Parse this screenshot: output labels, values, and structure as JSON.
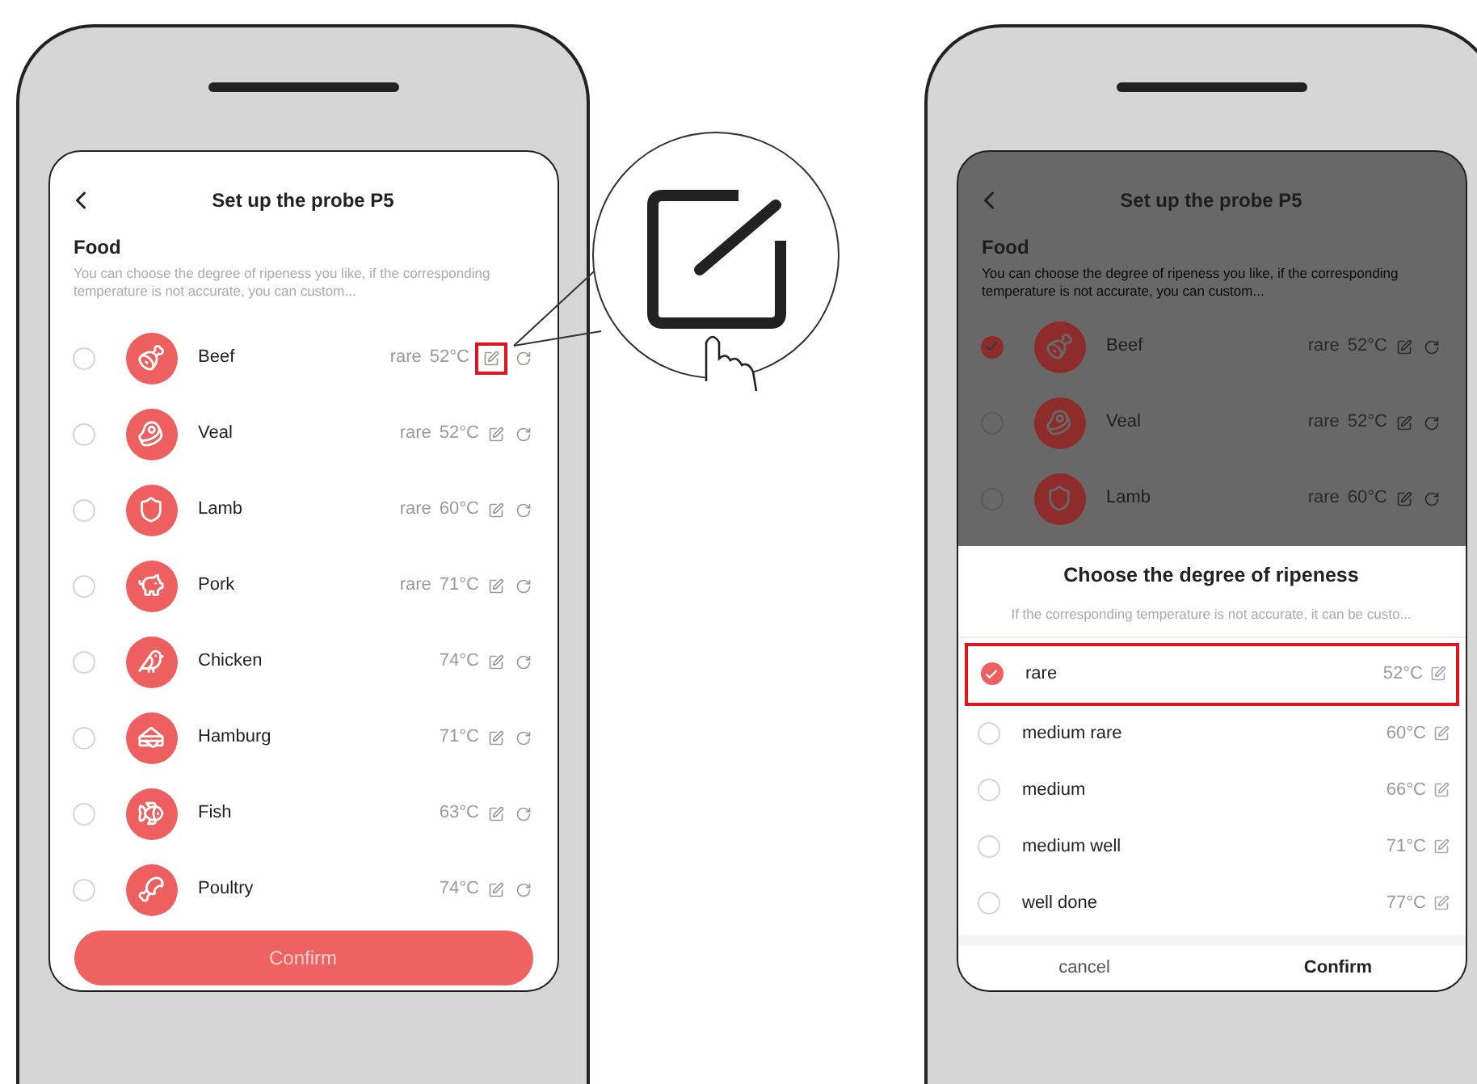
{
  "left_screen": {
    "title": "Set up the probe P5",
    "section_title": "Food",
    "description": "You can choose the degree of ripeness you like, if the corresponding temperature is not accurate, you can custom...",
    "foods": [
      {
        "name": "Beef",
        "doneness": "rare",
        "temp": "52°C",
        "selected": false
      },
      {
        "name": "Veal",
        "doneness": "rare",
        "temp": "52°C",
        "selected": false
      },
      {
        "name": "Lamb",
        "doneness": "rare",
        "temp": "60°C",
        "selected": false
      },
      {
        "name": "Pork",
        "doneness": "rare",
        "temp": "71°C",
        "selected": false
      },
      {
        "name": "Chicken",
        "temp": "74°C",
        "selected": false
      },
      {
        "name": "Hamburg",
        "temp": "71°C",
        "selected": false
      },
      {
        "name": "Fish",
        "temp": "63°C",
        "selected": false
      },
      {
        "name": "Poultry",
        "temp": "74°C",
        "selected": false
      }
    ],
    "confirm": "Confirm"
  },
  "right_screen": {
    "title": "Set up the probe P5",
    "section_title": "Food",
    "description": "You can choose the degree of ripeness you like, if the corresponding temperature is not accurate, you can custom...",
    "foods": [
      {
        "name": "Beef",
        "doneness": "rare",
        "temp": "52°C",
        "selected": true
      },
      {
        "name": "Veal",
        "doneness": "rare",
        "temp": "52°C",
        "selected": false
      },
      {
        "name": "Lamb",
        "doneness": "rare",
        "temp": "60°C",
        "selected": false
      }
    ],
    "dialog": {
      "title": "Choose the degree of ripeness",
      "description": "If the corresponding temperature is not accurate, it can be custo...",
      "options": [
        {
          "label": "rare",
          "temp": "52°C",
          "selected": true
        },
        {
          "label": "medium rare",
          "temp": "60°C",
          "selected": false
        },
        {
          "label": "medium",
          "temp": "66°C",
          "selected": false
        },
        {
          "label": "medium well",
          "temp": "71°C",
          "selected": false
        },
        {
          "label": "well done",
          "temp": "77°C",
          "selected": false
        }
      ],
      "cancel": "cancel",
      "confirm": "Confirm"
    }
  }
}
